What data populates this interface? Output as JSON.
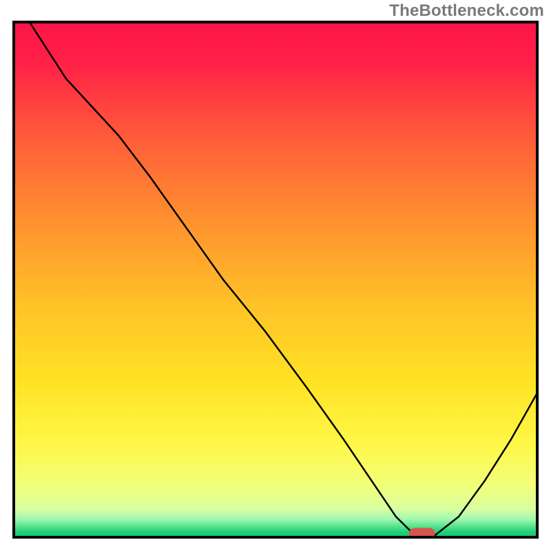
{
  "watermark": "TheBottleneck.com",
  "chart_data": {
    "type": "line",
    "title": "",
    "xlabel": "",
    "ylabel": "",
    "xlim": [
      0,
      100
    ],
    "ylim": [
      0,
      100
    ],
    "grid": false,
    "legend": false,
    "series": [
      {
        "name": "bottleneck-curve",
        "x": [
          3,
          10,
          20,
          26,
          33,
          40,
          48,
          56,
          63,
          69,
          73,
          76,
          80,
          85,
          90,
          95,
          100
        ],
        "values": [
          100,
          89,
          78,
          70,
          60,
          50,
          40,
          29,
          19,
          10,
          4,
          1,
          0,
          4,
          11,
          19,
          28
        ]
      }
    ],
    "marker": {
      "name": "optimal-point",
      "x": 78,
      "y": 0.8,
      "color": "#d9534f",
      "width": 5,
      "height": 2,
      "rx": 1.2
    },
    "gradient_stops": [
      {
        "offset": 0,
        "color": "#ff1448"
      },
      {
        "offset": 0.08,
        "color": "#ff2147"
      },
      {
        "offset": 0.22,
        "color": "#ff5a3a"
      },
      {
        "offset": 0.38,
        "color": "#ff8f2f"
      },
      {
        "offset": 0.55,
        "color": "#ffc228"
      },
      {
        "offset": 0.7,
        "color": "#ffe324"
      },
      {
        "offset": 0.82,
        "color": "#fff748"
      },
      {
        "offset": 0.9,
        "color": "#f2ff7a"
      },
      {
        "offset": 0.945,
        "color": "#d8ffa0"
      },
      {
        "offset": 0.965,
        "color": "#a0f7b0"
      },
      {
        "offset": 0.978,
        "color": "#5ce48e"
      },
      {
        "offset": 0.99,
        "color": "#1fd07a"
      },
      {
        "offset": 1.0,
        "color": "#12c873"
      }
    ],
    "frame": {
      "stroke": "#000000",
      "stroke_width": 4,
      "inset": 20
    }
  }
}
